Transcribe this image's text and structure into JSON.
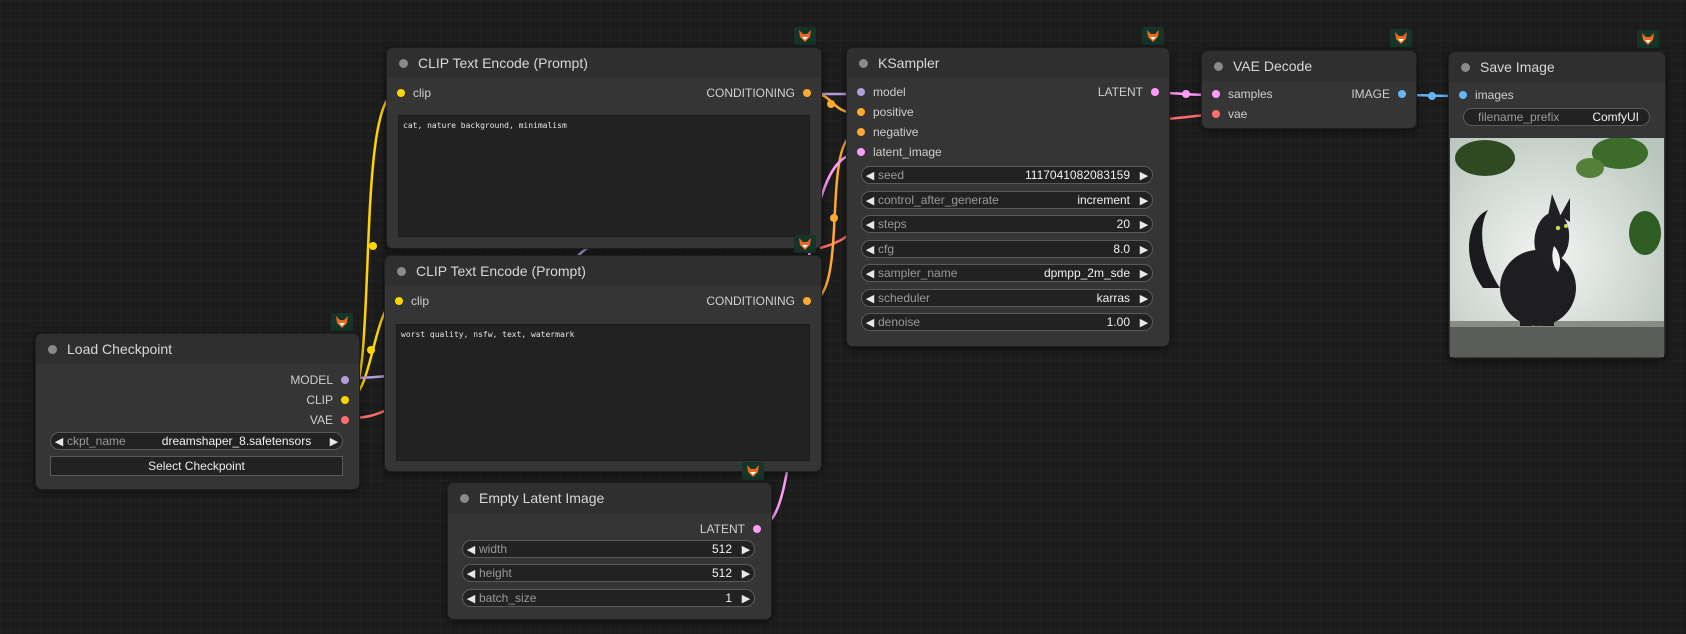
{
  "nodes": {
    "clip_text_encode_1": {
      "title": "CLIP Text Encode (Prompt)",
      "input_clip": "clip",
      "output": "CONDITIONING",
      "text": "cat, nature background, minimalism"
    },
    "clip_text_encode_2": {
      "title": "CLIP Text Encode (Prompt)",
      "input_clip": "clip",
      "output": "CONDITIONING",
      "text": "worst quality, nsfw, text, watermark"
    },
    "ksampler": {
      "title": "KSampler",
      "inputs": [
        "model",
        "positive",
        "negative",
        "latent_image"
      ],
      "output": "LATENT",
      "widgets": [
        {
          "label": "seed",
          "value": "1117041082083159"
        },
        {
          "label": "control_after_generate",
          "value": "increment"
        },
        {
          "label": "steps",
          "value": "20"
        },
        {
          "label": "cfg",
          "value": "8.0"
        },
        {
          "label": "sampler_name",
          "value": "dpmpp_2m_sde"
        },
        {
          "label": "scheduler",
          "value": "karras"
        },
        {
          "label": "denoise",
          "value": "1.00"
        }
      ]
    },
    "vae_decode": {
      "title": "VAE Decode",
      "inputs": [
        "samples",
        "vae"
      ],
      "output": "IMAGE"
    },
    "save_image": {
      "title": "Save Image",
      "input_images": "images",
      "filename_prefix": {
        "label": "filename_prefix",
        "value": "ComfyUI"
      }
    },
    "load_checkpoint": {
      "title": "Load Checkpoint",
      "outputs": [
        "MODEL",
        "CLIP",
        "VAE"
      ],
      "ckpt_name": {
        "label": "ckpt_name",
        "value": "dreamshaper_8.safetensors"
      },
      "button": "Select Checkpoint"
    },
    "empty_latent": {
      "title": "Empty Latent Image",
      "output": "LATENT",
      "widgets": [
        {
          "label": "width",
          "value": "512"
        },
        {
          "label": "height",
          "value": "512"
        },
        {
          "label": "batch_size",
          "value": "1"
        }
      ]
    }
  },
  "icons": {
    "node_badge": "fox-icon",
    "widget_decrement": "arrow-left-icon",
    "widget_increment": "arrow-right-icon"
  },
  "colors": {
    "model": "#b39ddb",
    "clip": "#ffd500",
    "vae": "#ff6e6e",
    "conditioning": "#ffa931",
    "latent": "#ff9cf9",
    "image": "#64b5f6",
    "badge_bg": "#143528"
  }
}
